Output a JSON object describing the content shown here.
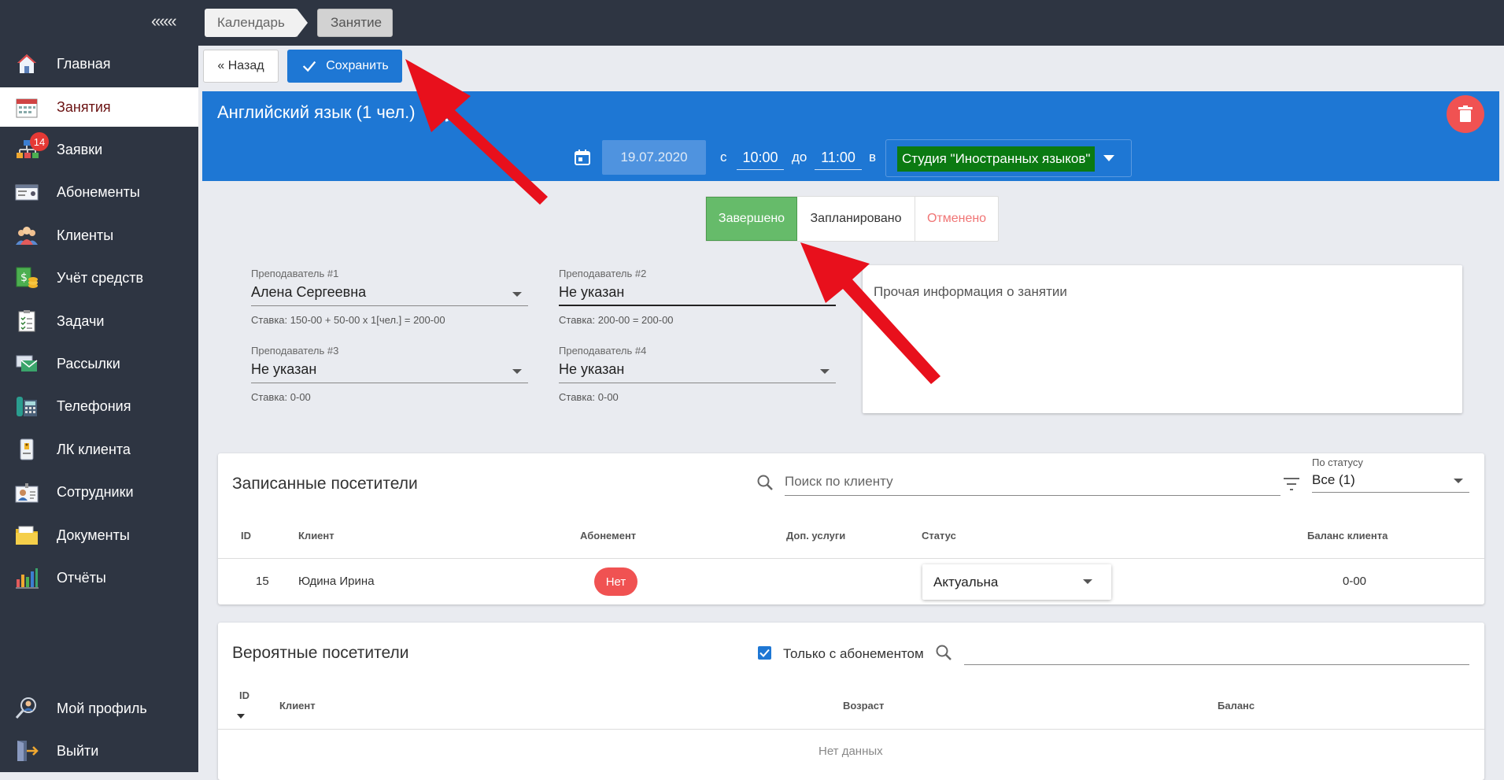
{
  "sidebar": {
    "collapse_label": "«««",
    "items": [
      {
        "label": "Главная",
        "icon": "home-icon"
      },
      {
        "label": "Занятия",
        "icon": "calendar-icon",
        "active": true
      },
      {
        "label": "Заявки",
        "icon": "requests-icon",
        "badge": "14"
      },
      {
        "label": "Абонементы",
        "icon": "subscription-card-icon"
      },
      {
        "label": "Клиенты",
        "icon": "clients-icon"
      },
      {
        "label": "Учёт средств",
        "icon": "money-icon"
      },
      {
        "label": "Задачи",
        "icon": "tasks-icon"
      },
      {
        "label": "Рассылки",
        "icon": "mailing-icon"
      },
      {
        "label": "Телефония",
        "icon": "phone-icon"
      },
      {
        "label": "ЛК клиента",
        "icon": "client-account-icon"
      },
      {
        "label": "Сотрудники",
        "icon": "staff-icon"
      },
      {
        "label": "Документы",
        "icon": "documents-icon"
      },
      {
        "label": "Отчёты",
        "icon": "reports-icon"
      }
    ],
    "bottom_items": [
      {
        "label": "Мой профиль",
        "icon": "profile-icon"
      },
      {
        "label": "Выйти",
        "icon": "logout-icon"
      }
    ]
  },
  "breadcrumbs": [
    "Календарь",
    "Занятие"
  ],
  "toolbar": {
    "back_label": "« Назад",
    "save_label": "Сохранить"
  },
  "lesson": {
    "title": "Английский язык (1 чел.)",
    "date": "19.07.2020",
    "from_label": "с",
    "time_from": "10:00",
    "to_label": "до",
    "time_to": "11:00",
    "in_label": "в",
    "room": "Студия \"Иностранных языков\""
  },
  "status_buttons": [
    "Завершено",
    "Запланировано",
    "Отменено"
  ],
  "teachers": [
    {
      "label": "Преподаватель #1",
      "value": "Алена Сергеевна",
      "rate": "Ставка: 150-00 + 50-00 x 1[чел.] = 200-00"
    },
    {
      "label": "Преподаватель #2",
      "value": "Не указан",
      "rate": "Ставка: 200-00 = 200-00"
    },
    {
      "label": "Преподаватель #3",
      "value": "Не указан",
      "rate": "Ставка: 0-00"
    },
    {
      "label": "Преподаватель #4",
      "value": "Не указан",
      "rate": "Ставка: 0-00"
    }
  ],
  "notes_placeholder": "Прочая информация о занятии",
  "enrolled": {
    "title": "Записанные посетители",
    "search_placeholder": "Поиск по клиенту",
    "filter_label": "По статусу",
    "filter_value": "Все (1)",
    "columns": [
      "ID",
      "Клиент",
      "Абонемент",
      "Доп. услуги",
      "Статус",
      "Баланс клиента"
    ],
    "rows": [
      {
        "id": "15",
        "client": "Юдина Ирина",
        "subscription": "Нет",
        "extra": "",
        "status": "Актуальна",
        "balance": "0-00"
      }
    ]
  },
  "probable": {
    "title": "Вероятные посетители",
    "only_with_subscription_label": "Только с абонементом",
    "only_with_subscription_checked": true,
    "columns": [
      "ID",
      "Клиент",
      "Возраст",
      "Баланс"
    ],
    "empty_text": "Нет данных"
  },
  "colors": {
    "sidebar_bg": "#2e3542",
    "header_blue": "#1e77d4",
    "done_green": "#66bb6a",
    "danger_red": "#f05252",
    "arrow_red": "#e8101c"
  }
}
